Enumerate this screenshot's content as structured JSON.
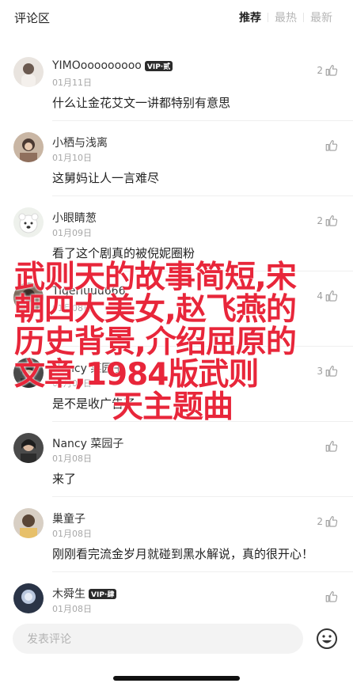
{
  "header": {
    "title": "评论区",
    "tabs": [
      {
        "label": "推荐",
        "active": true
      },
      {
        "label": "最热",
        "active": false
      },
      {
        "label": "最新",
        "active": false
      }
    ]
  },
  "comments": [
    {
      "user": "YIMOooooooooo",
      "vip": "VIP·贰",
      "date": "01月11日",
      "text": "什么让金花艾文一讲都特别有意思",
      "likes": "2"
    },
    {
      "user": "小栖与浅离",
      "vip": "",
      "date": "01月10日",
      "text": "这舅妈让人一言难尽",
      "likes": ""
    },
    {
      "user": "小眼睛葱",
      "vip": "",
      "date": "01月09日",
      "text": "看了这个剧真的被倪妮圈粉",
      "likes": "2"
    },
    {
      "user": "Tigerluuu666",
      "vip": "",
      "date": "01月08日",
      "text": "",
      "likes": "4"
    },
    {
      "user": "Nancy 菜园子",
      "vip": "",
      "date": "01月08日",
      "text": "是不是收广告了",
      "likes": "3"
    },
    {
      "user": "Nancy 菜园子",
      "vip": "",
      "date": "01月08日",
      "text": "来了",
      "likes": ""
    },
    {
      "user": "巢童子",
      "vip": "",
      "date": "01月08日",
      "text": "刚刚看完流金岁月就碰到黑水解说，真的很开心！",
      "likes": "2"
    },
    {
      "user": "木舜生",
      "vip": "VIP·肆",
      "date": "01月08日",
      "text": "",
      "likes": ""
    }
  ],
  "overlay": {
    "lines": [
      "武则天的故事简短,宋",
      "朝四大美女,赵飞燕的",
      "历史背景,介绍屈原的",
      "文章,1984版武则",
      "天主题曲"
    ]
  },
  "bottom": {
    "placeholder": "发表评论"
  }
}
